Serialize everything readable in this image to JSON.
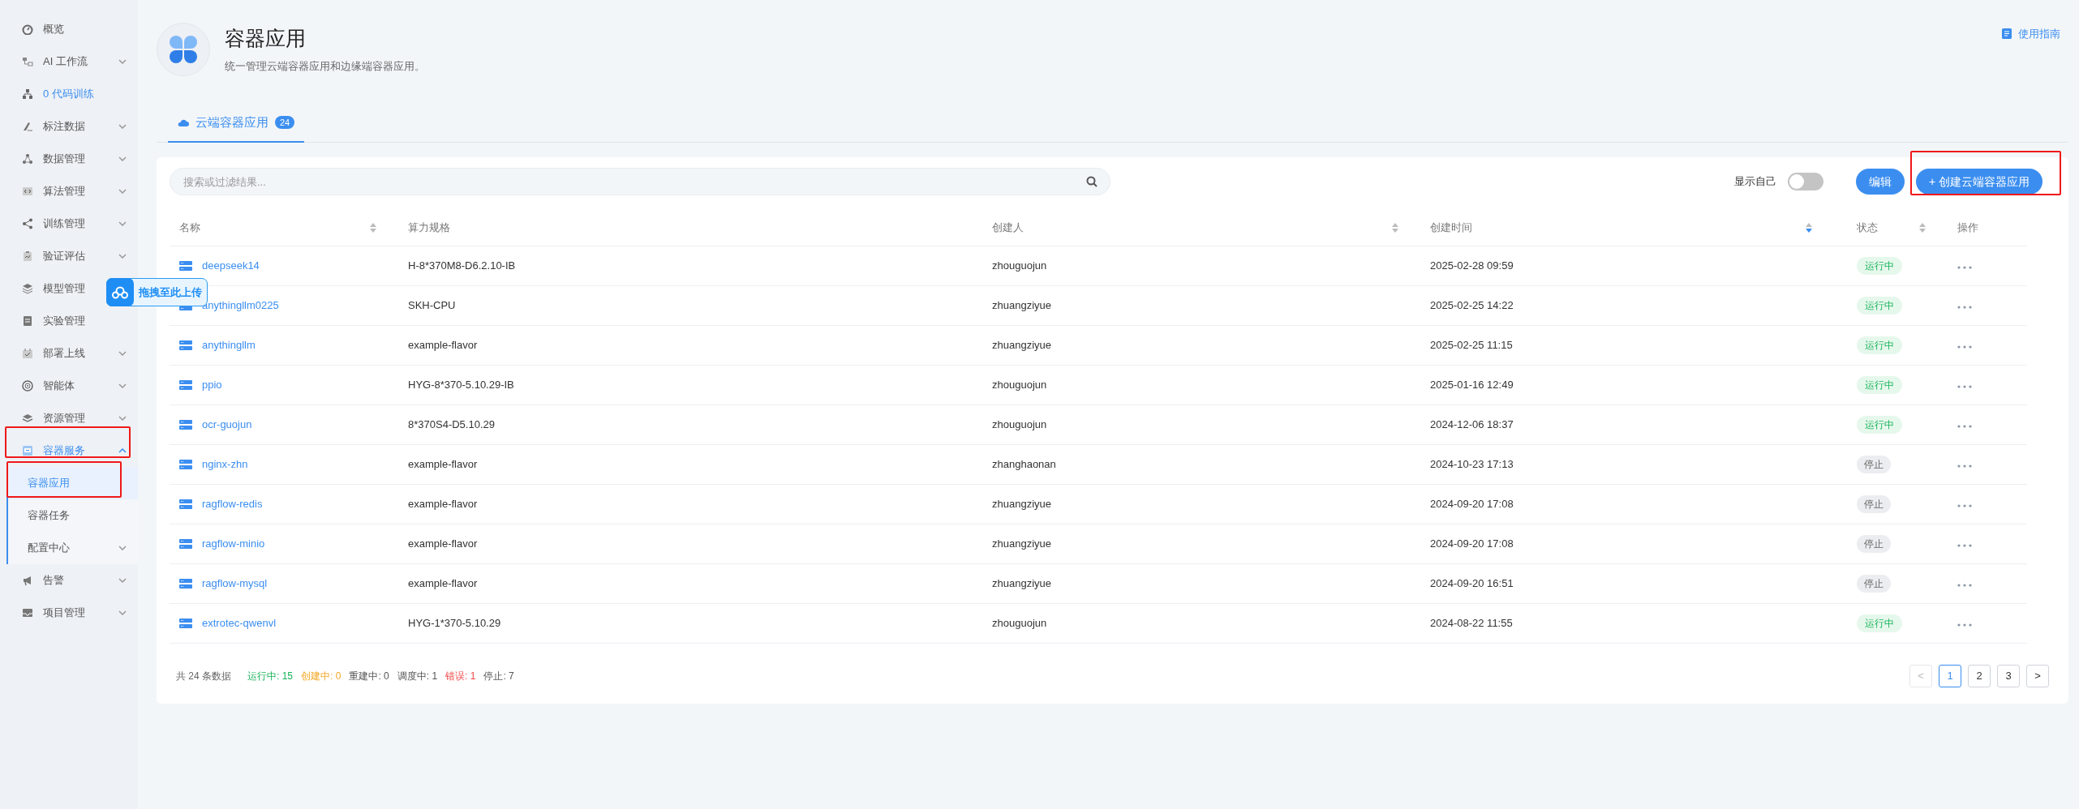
{
  "sidebar": {
    "items": [
      {
        "label": "概览",
        "active": false
      },
      {
        "label": "AI 工作流",
        "active": false,
        "expanded": false
      },
      {
        "label": "0 代码训练",
        "active": true
      },
      {
        "label": "标注数据",
        "active": false,
        "expanded": false
      },
      {
        "label": "数据管理",
        "active": false,
        "expanded": false
      },
      {
        "label": "算法管理",
        "active": false,
        "expanded": false
      },
      {
        "label": "训练管理",
        "active": false,
        "expanded": false
      },
      {
        "label": "验证评估",
        "active": false,
        "expanded": false
      },
      {
        "label": "模型管理",
        "active": false
      },
      {
        "label": "实验管理",
        "active": false
      },
      {
        "label": "部署上线",
        "active": false,
        "expanded": false
      },
      {
        "label": "智能体",
        "active": false,
        "expanded": false
      },
      {
        "label": "资源管理",
        "active": false,
        "expanded": false
      },
      {
        "label": "容器服务",
        "active": true,
        "expanded": true,
        "children": [
          {
            "label": "容器应用",
            "selected": true
          },
          {
            "label": "容器任务",
            "selected": false
          },
          {
            "label": "配置中心",
            "selected": false,
            "expanded": false
          }
        ]
      },
      {
        "label": "告警",
        "active": false,
        "expanded": false
      },
      {
        "label": "项目管理",
        "active": false,
        "expanded": false
      }
    ]
  },
  "upload_widget": {
    "label": "拖拽至此上传"
  },
  "header": {
    "title": "容器应用",
    "subtitle": "统一管理云端容器应用和边缘端容器应用。",
    "guide_link": "使用指南"
  },
  "tabs": [
    {
      "label": "云端容器应用",
      "count": "24",
      "selected": true
    }
  ],
  "toolbar": {
    "search": {
      "placeholder": "搜索或过滤结果..."
    },
    "show_mine": {
      "label": "显示自己",
      "on": false
    },
    "edit_button": "编辑",
    "create_button": {
      "icon": "+",
      "label": "创建云端容器应用"
    }
  },
  "table": {
    "columns": [
      {
        "label": "名称",
        "sortable": true,
        "sorted": false
      },
      {
        "label": "算力规格",
        "sortable": false
      },
      {
        "label": "创建人",
        "sortable": true,
        "sorted": false
      },
      {
        "label": "创建时间",
        "sortable": true,
        "sorted": true
      },
      {
        "label": "状态",
        "sortable": true,
        "sorted": false
      },
      {
        "label": "操作",
        "sortable": false
      }
    ],
    "rows": [
      {
        "name": "deepseek14",
        "spec": "H-8*370M8-D6.2.10-IB",
        "creator": "zhouguojun",
        "created": "2025-02-28 09:59",
        "status": "运行中",
        "kind": "running"
      },
      {
        "name": "anythingllm0225",
        "spec": "SKH-CPU",
        "creator": "zhuangziyue",
        "created": "2025-02-25 14:22",
        "status": "运行中",
        "kind": "running"
      },
      {
        "name": "anythingllm",
        "spec": "example-flavor",
        "creator": "zhuangziyue",
        "created": "2025-02-25 11:15",
        "status": "运行中",
        "kind": "running"
      },
      {
        "name": "ppio",
        "spec": "HYG-8*370-5.10.29-IB",
        "creator": "zhouguojun",
        "created": "2025-01-16 12:49",
        "status": "运行中",
        "kind": "running"
      },
      {
        "name": "ocr-guojun",
        "spec": "8*370S4-D5.10.29",
        "creator": "zhouguojun",
        "created": "2024-12-06 18:37",
        "status": "运行中",
        "kind": "running"
      },
      {
        "name": "nginx-zhn",
        "spec": "example-flavor",
        "creator": "zhanghaonan",
        "created": "2024-10-23 17:13",
        "status": "停止",
        "kind": "stopped"
      },
      {
        "name": "ragflow-redis",
        "spec": "example-flavor",
        "creator": "zhuangziyue",
        "created": "2024-09-20 17:08",
        "status": "停止",
        "kind": "stopped"
      },
      {
        "name": "ragflow-minio",
        "spec": "example-flavor",
        "creator": "zhuangziyue",
        "created": "2024-09-20 17:08",
        "status": "停止",
        "kind": "stopped"
      },
      {
        "name": "ragflow-mysql",
        "spec": "example-flavor",
        "creator": "zhuangziyue",
        "created": "2024-09-20 16:51",
        "status": "停止",
        "kind": "stopped"
      },
      {
        "name": "extrotec-qwenvl",
        "spec": "HYG-1*370-5.10.29",
        "creator": "zhouguojun",
        "created": "2024-08-22 11:55",
        "status": "运行中",
        "kind": "running"
      }
    ]
  },
  "footer": {
    "total": "共 24 条数据",
    "stats": [
      {
        "label": "运行中: 15",
        "color": "#19b35a"
      },
      {
        "label": "创建中: 0",
        "color": "#f5a623"
      },
      {
        "label": "重建中: 0",
        "color": "#555555"
      },
      {
        "label": "调度中: 1",
        "color": "#555555"
      },
      {
        "label": "错误: 1",
        "color": "#f04a4a"
      },
      {
        "label": "停止: 7",
        "color": "#555555"
      }
    ],
    "pagination": {
      "prev": "<",
      "pages": [
        {
          "label": "1",
          "selected": true
        },
        {
          "label": "2",
          "selected": false
        },
        {
          "label": "3",
          "selected": false
        }
      ],
      "next": ">"
    }
  }
}
